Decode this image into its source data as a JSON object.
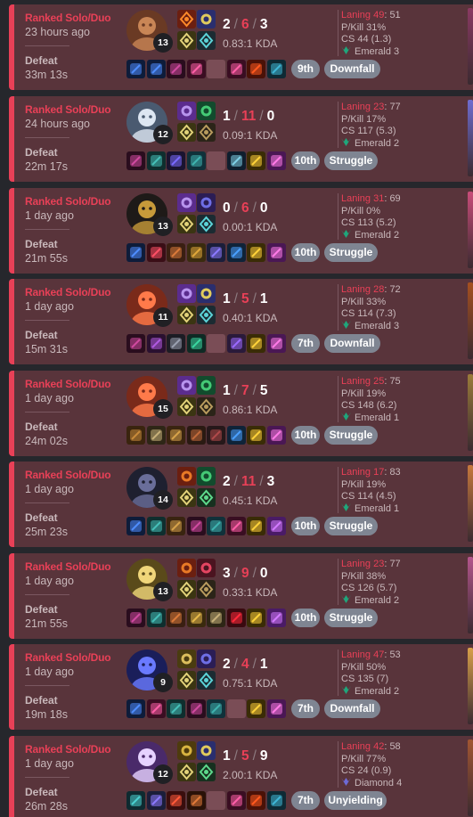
{
  "colors": {
    "defeat_accent": "#e84057",
    "card_bg": "#59343b",
    "emerald": "#1fa67b",
    "diamond": "#6d6bd6",
    "pill": "#7f8592"
  },
  "matches": [
    {
      "queue": "Ranked Solo/Duo",
      "ago": "23 hours ago",
      "result": "Defeat",
      "duration": "33m 13s",
      "level": "13",
      "kills": "2",
      "deaths": "6",
      "assists": "3",
      "kda_ratio": "0.83:1 KDA",
      "placement": "9th",
      "tag": "Downfall",
      "laning_label": "Laning 49",
      "laning_opp": ": 51",
      "pkill": "P/Kill 31%",
      "cs": "CS 44 (1.3)",
      "rank": "Emerald 3",
      "rank_tier": "emerald",
      "champ_icon": "tan-demon-champion-icon",
      "spells": [
        "ignite-rune-icon",
        "flash-spell-icon",
        "hail-rune-icon",
        "inspiration-rune-icon"
      ],
      "items": [
        "purple-orb-item-icon",
        "blue-orb-item-icon",
        "crimson-blade-item-icon",
        "mask-item-icon",
        "empty",
        "demon-mask-item-icon",
        "flame-crest-item-icon",
        "ward-lens-item-icon"
      ]
    },
    {
      "queue": "Ranked Solo/Duo",
      "ago": "24 hours ago",
      "result": "Defeat",
      "duration": "22m 17s",
      "level": "12",
      "kills": "1",
      "deaths": "11",
      "assists": "0",
      "kda_ratio": "0.09:1 KDA",
      "placement": "10th",
      "tag": "Struggle",
      "laning_label": "Laning 23",
      "laning_opp": ": 77",
      "pkill": "P/Kill 17%",
      "cs": "CS 117 (5.3)",
      "rank": "Emerald 2",
      "rank_tier": "emerald",
      "champ_icon": "white-haired-champion-icon",
      "spells": [
        "ghost-spell-icon",
        "heal-spell-icon",
        "lethal-rune-icon",
        "precision-rune-icon"
      ],
      "items": [
        "blade-item-icon",
        "bow-item-icon",
        "scythe-item-icon",
        "cloak-item-icon",
        "empty",
        "sword-item-icon",
        "gold-ward-item-icon",
        "boots-item-icon"
      ]
    },
    {
      "queue": "Ranked Solo/Duo",
      "ago": "1 day ago",
      "result": "Defeat",
      "duration": "21m 55s",
      "level": "13",
      "kills": "0",
      "deaths": "6",
      "assists": "0",
      "kda_ratio": "0.00:1 KDA",
      "placement": "10th",
      "tag": "Struggle",
      "laning_label": "Laning 31",
      "laning_opp": ": 69",
      "pkill": "P/Kill 0%",
      "cs": "CS 113 (5.2)",
      "rank": "Emerald 2",
      "rank_tier": "emerald",
      "champ_icon": "dark-beast-champion-icon",
      "spells": [
        "ghost-spell-icon",
        "teleport-spell-icon",
        "lethal-rune-icon",
        "sorcery-rune-icon"
      ],
      "items": [
        "orb-item-icon",
        "rose-item-icon",
        "fist-item-icon",
        "glove-item-icon",
        "crown-item-icon",
        "shield-item-icon",
        "gold-ward-item-icon",
        "boots-item-icon"
      ]
    },
    {
      "queue": "Ranked Solo/Duo",
      "ago": "1 day ago",
      "result": "Defeat",
      "duration": "15m 31s",
      "level": "11",
      "kills": "1",
      "deaths": "5",
      "assists": "1",
      "kda_ratio": "0.40:1 KDA",
      "placement": "7th",
      "tag": "Downfall",
      "laning_label": "Laning 28",
      "laning_opp": ": 72",
      "pkill": "P/Kill 33%",
      "cs": "CS 114 (7.3)",
      "rank": "Emerald 3",
      "rank_tier": "emerald",
      "champ_icon": "red-creature-champion-icon",
      "spells": [
        "ghost-spell-icon",
        "flash-spell-icon",
        "lethal-rune-icon",
        "sorcery-rune-icon"
      ],
      "items": [
        "blade-item-icon",
        "dagger-item-icon",
        "arc-item-icon",
        "gem-item-icon",
        "empty",
        "potion-item-icon",
        "gold-ward-item-icon",
        "boots-item-icon"
      ]
    },
    {
      "queue": "Ranked Solo/Duo",
      "ago": "1 day ago",
      "result": "Defeat",
      "duration": "24m 02s",
      "level": "15",
      "kills": "1",
      "deaths": "7",
      "assists": "5",
      "kda_ratio": "0.86:1 KDA",
      "placement": "10th",
      "tag": "Struggle",
      "laning_label": "Laning 25",
      "laning_opp": ": 75",
      "pkill": "P/Kill 19%",
      "cs": "CS 148 (6.2)",
      "rank": "Emerald 1",
      "rank_tier": "emerald",
      "champ_icon": "armored-beast-champion-icon",
      "spells": [
        "ghost-spell-icon",
        "heal-spell-icon",
        "lethal-rune-icon",
        "precision-rune-icon"
      ],
      "items": [
        "bronze-item-icon",
        "tooth-item-icon",
        "claw-item-icon",
        "cleaver-item-icon",
        "hammer-item-icon",
        "shield-item-icon",
        "gold-ward-item-icon",
        "boots-item-icon"
      ]
    },
    {
      "queue": "Ranked Solo/Duo",
      "ago": "1 day ago",
      "result": "Defeat",
      "duration": "25m 23s",
      "level": "14",
      "kills": "2",
      "deaths": "11",
      "assists": "3",
      "kda_ratio": "0.45:1 KDA",
      "placement": "10th",
      "tag": "Struggle",
      "laning_label": "Laning 17",
      "laning_opp": ": 83",
      "pkill": "P/Kill 19%",
      "cs": "CS 114 (4.5)",
      "rank": "Emerald 1",
      "rank_tier": "emerald",
      "champ_icon": "hooded-champion-icon",
      "spells": [
        "ignite-spell-icon",
        "heal-spell-icon",
        "conqueror-rune-icon",
        "resolve-rune-icon"
      ],
      "items": [
        "orb-item-icon",
        "bow-item-icon",
        "claw-item-icon",
        "blade-item-icon",
        "cloak-item-icon",
        "mask-item-icon",
        "gold-ward-item-icon",
        "crystal-item-icon"
      ]
    },
    {
      "queue": "Ranked Solo/Duo",
      "ago": "1 day ago",
      "result": "Defeat",
      "duration": "21m 55s",
      "level": "13",
      "kills": "3",
      "deaths": "9",
      "assists": "0",
      "kda_ratio": "0.33:1 KDA",
      "placement": "10th",
      "tag": "Struggle",
      "laning_label": "Laning 23",
      "laning_opp": ": 77",
      "pkill": "P/Kill 38%",
      "cs": "CS 126 (5.7)",
      "rank": "Emerald 2",
      "rank_tier": "emerald",
      "champ_icon": "golden-fist-champion-icon",
      "spells": [
        "ignite-spell-icon",
        "swirl-spell-icon",
        "lethal-rune-icon",
        "precision-rune-icon"
      ],
      "items": [
        "blade-item-icon",
        "bow-item-icon",
        "fist-item-icon",
        "gauntlet-item-icon",
        "tooth-item-icon",
        "ruby-item-icon",
        "gold-ward-item-icon",
        "crystal-item-icon"
      ]
    },
    {
      "queue": "Ranked Solo/Duo",
      "ago": "1 day ago",
      "result": "Defeat",
      "duration": "19m 18s",
      "level": "9",
      "kills": "2",
      "deaths": "4",
      "assists": "1",
      "kda_ratio": "0.75:1 KDA",
      "placement": "7th",
      "tag": "Downfall",
      "laning_label": "Laning 47",
      "laning_opp": ": 53",
      "pkill": "P/Kill 50%",
      "cs": "CS 135 (7)",
      "rank": "Emerald 2",
      "rank_tier": "emerald",
      "champ_icon": "blue-dragon-champion-icon",
      "spells": [
        "barrier-spell-icon",
        "teleport-spell-icon",
        "lethal-rune-icon",
        "inspiration-rune-icon"
      ],
      "items": [
        "orb-item-icon",
        "mask-item-icon",
        "bow-item-icon",
        "blade-item-icon",
        "cloak-item-icon",
        "empty",
        "gold-ward-item-icon",
        "boots-item-icon"
      ]
    },
    {
      "queue": "Ranked Solo/Duo",
      "ago": "1 day ago",
      "result": "Defeat",
      "duration": "26m 28s",
      "level": "12",
      "kills": "1",
      "deaths": "5",
      "assists": "9",
      "kda_ratio": "2.00:1 KDA",
      "placement": "7th",
      "tag": "Unyielding",
      "laning_label": "Laning 42",
      "laning_opp": ": 58",
      "pkill": "P/Kill 77%",
      "cs": "CS 24 (0.9)",
      "rank": "Diamond 4",
      "rank_tier": "diamond",
      "champ_icon": "purple-poro-champion-icon",
      "spells": [
        "exhaust-spell-icon",
        "flash-spell-icon",
        "guardian-rune-icon",
        "resolve-rune-icon"
      ],
      "items": [
        "eye-item-icon",
        "crown-item-icon",
        "flame-item-icon",
        "book-item-icon",
        "empty",
        "mask-item-icon",
        "flame-crest-item-icon",
        "ward-lens-item-icon"
      ]
    }
  ]
}
